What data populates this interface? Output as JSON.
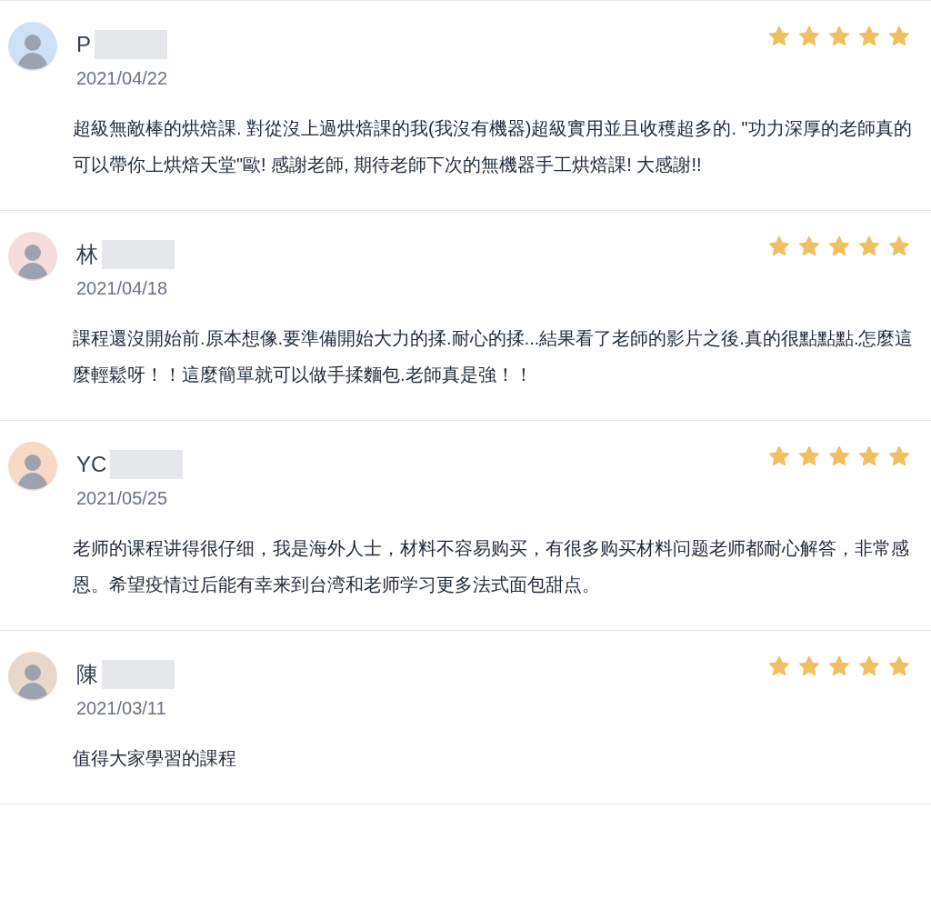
{
  "reviews": [
    {
      "name": "P",
      "color": "#cfe0f5",
      "date": "2021/04/22",
      "stars": 5,
      "text": "超級無敵棒的烘焙課. 對從沒上過烘焙課的我(我沒有機器)超級實用並且收穫超多的. \"功力深厚的老師真的可以帶你上烘焙天堂\"歐! 感謝老師, 期待老師下次的無機器手工烘焙課! 大感謝!!"
    },
    {
      "name": "林",
      "color": "#f6dcdc",
      "date": "2021/04/18",
      "stars": 5,
      "text": "課程還沒開始前.原本想像.要準備開始大力的揉.耐心的揉...結果看了老師的影片之後.真的很點點點.怎麼這麼輕鬆呀！！這麼簡單就可以做手揉麵包.老師真是強！！"
    },
    {
      "name": "YC",
      "color": "#f7d9c8",
      "date": "2021/05/25",
      "stars": 5,
      "text": "老师的课程讲得很仔细，我是海外人士，材料不容易购买，有很多购买材料问题老师都耐心解答，非常感恩。希望疫情过后能有幸来到台湾和老师学习更多法式面包甜点。"
    },
    {
      "name": "陳",
      "color": "#e8d8cc",
      "date": "2021/03/11",
      "stars": 5,
      "text": "值得大家學習的課程"
    }
  ]
}
